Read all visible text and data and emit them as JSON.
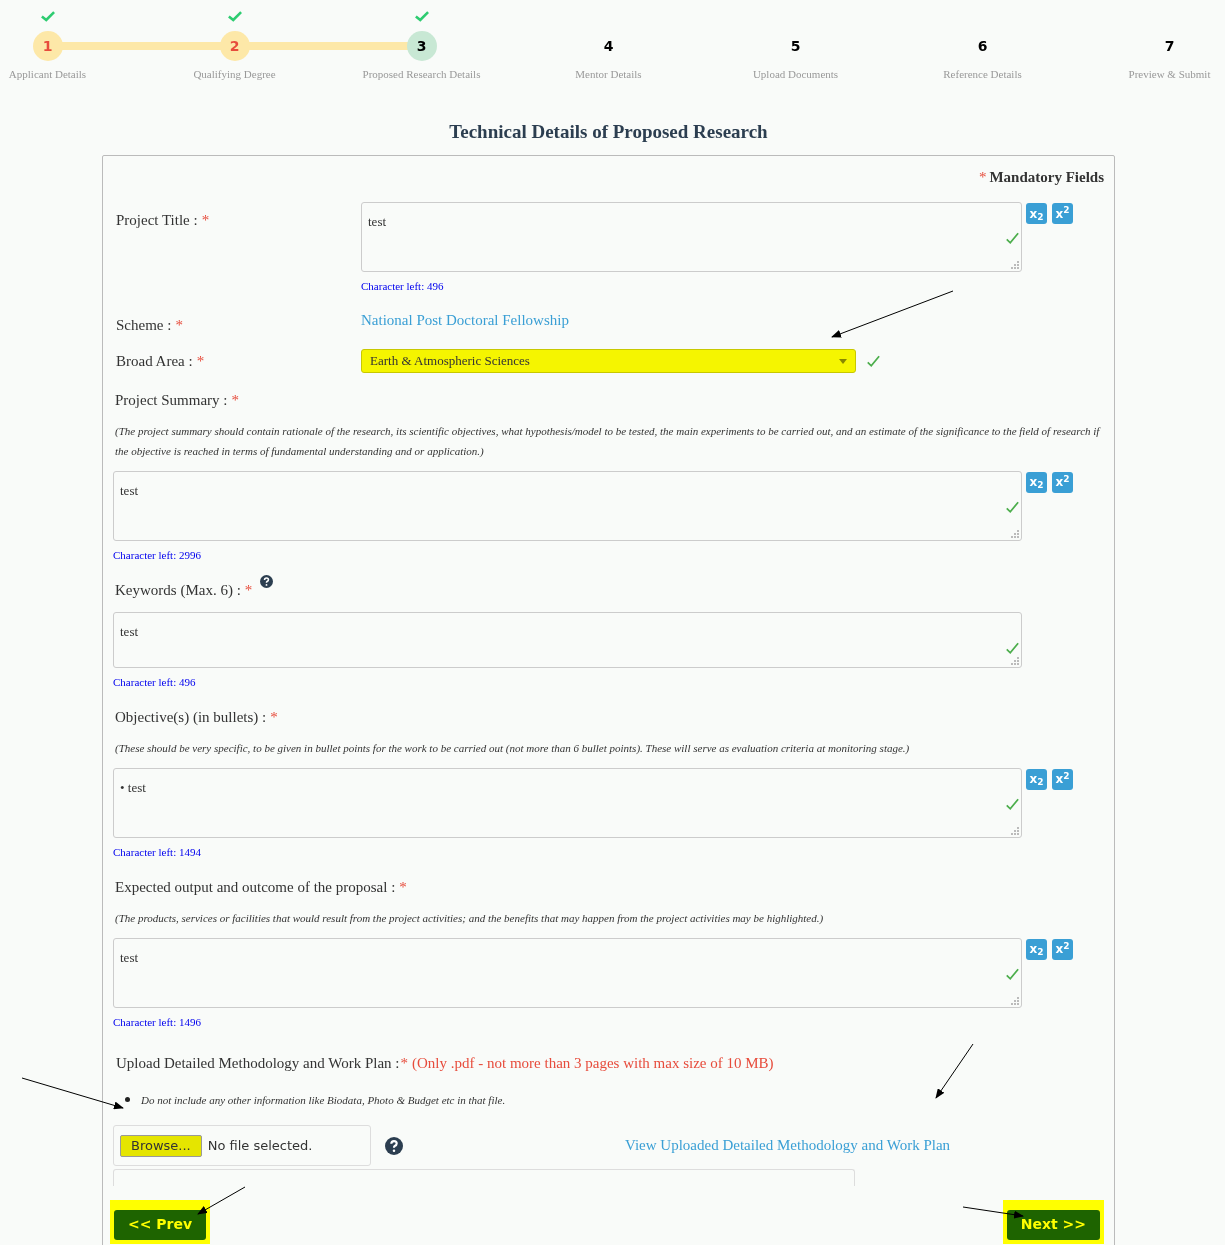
{
  "steps": [
    {
      "number": "1",
      "label": "Applicant Details",
      "completed": true,
      "current": false,
      "checked": true
    },
    {
      "number": "2",
      "label": "Qualifying Degree",
      "completed": true,
      "current": false,
      "checked": true
    },
    {
      "number": "3",
      "label": "Proposed Research Details",
      "completed": false,
      "current": true,
      "checked": true
    },
    {
      "number": "4",
      "label": "Mentor Details",
      "completed": false,
      "current": false,
      "checked": false
    },
    {
      "number": "5",
      "label": "Upload Documents",
      "completed": false,
      "current": false,
      "checked": false
    },
    {
      "number": "6",
      "label": "Reference Details",
      "completed": false,
      "current": false,
      "checked": false
    },
    {
      "number": "7",
      "label": "Preview & Submit",
      "completed": false,
      "current": false,
      "checked": false
    }
  ],
  "title": "Technical Details of Proposed Research",
  "mandatory_note": {
    "mark": "*",
    "text": "Mandatory Fields"
  },
  "fields": [
    {
      "kind": "inline_textarea",
      "label": "Project Title :",
      "required_mark": "*",
      "value": "test",
      "valid": true,
      "counter": "Character left: 496",
      "format_buttons": [
        "x$_{2}$",
        "x$^{2}$"
      ]
    },
    {
      "kind": "link_value",
      "label": "Scheme :",
      "required_mark": "*",
      "value": "National Post Doctoral Fellowship"
    },
    {
      "kind": "select",
      "label": "Broad Area :",
      "required_mark": "*",
      "value": "Earth & Atmospheric Sciences",
      "valid": true,
      "highlighted": true
    },
    {
      "kind": "block_textarea",
      "label": "Project Summary :",
      "required_mark": "*",
      "note": "(The project summary should contain rationale of the research, its scientific objectives, what hypothesis/model to be tested, the main experiments to be carried out, and an estimate of the significance to the field of research if the objective is reached in terms of fundamental understanding and or application.)",
      "value": "test",
      "valid": true,
      "counter": "Character left: 2996",
      "format_buttons": [
        "x$_{2}$",
        "x$^{2}$"
      ]
    },
    {
      "kind": "block_textarea",
      "label": "Keywords (Max. 6) :",
      "required_mark": "*",
      "help": true,
      "value": "test",
      "valid": true,
      "counter": "Character left: 496"
    },
    {
      "kind": "block_textarea",
      "label": "Objective(s) (in bullets) :",
      "required_mark": "*",
      "note": "(These should be very specific, to be given in bullet points for the work to be carried out (not more than 6 bullet points). These will serve as evaluation criteria at monitoring stage.)",
      "value": "• test",
      "valid": true,
      "counter": "Character left: 1494",
      "format_buttons": [
        "x$_{2}$",
        "x$^{2}$"
      ]
    },
    {
      "kind": "block_textarea",
      "label": "Expected output and outcome of the proposal :",
      "required_mark": "*",
      "note": "(The products, services or facilities that would result from the project activities; and the benefits that may happen from the project activities may be highlighted.)",
      "value": "test",
      "valid": true,
      "counter": "Character left: 1496",
      "format_buttons": [
        "x$_{2}$",
        "x$^{2}$"
      ]
    },
    {
      "kind": "upload",
      "label": "Upload Detailed Methodology and Work Plan :",
      "required_mark": "*",
      "hint": "(Only .pdf - not more than 3 pages with max size of 10 MB)",
      "bullets": [
        "Do not include any other information like Biodata, Photo & Budget etc in that file."
      ],
      "browse_label": "Browse...",
      "file_status": "No file selected.",
      "highlighted": true,
      "link": "View Uploaded Detailed Methodology and Work Plan"
    }
  ],
  "prev": {
    "label": "<< Prev",
    "highlighted": true
  },
  "next": {
    "label": "Next >>",
    "highlighted": true
  }
}
